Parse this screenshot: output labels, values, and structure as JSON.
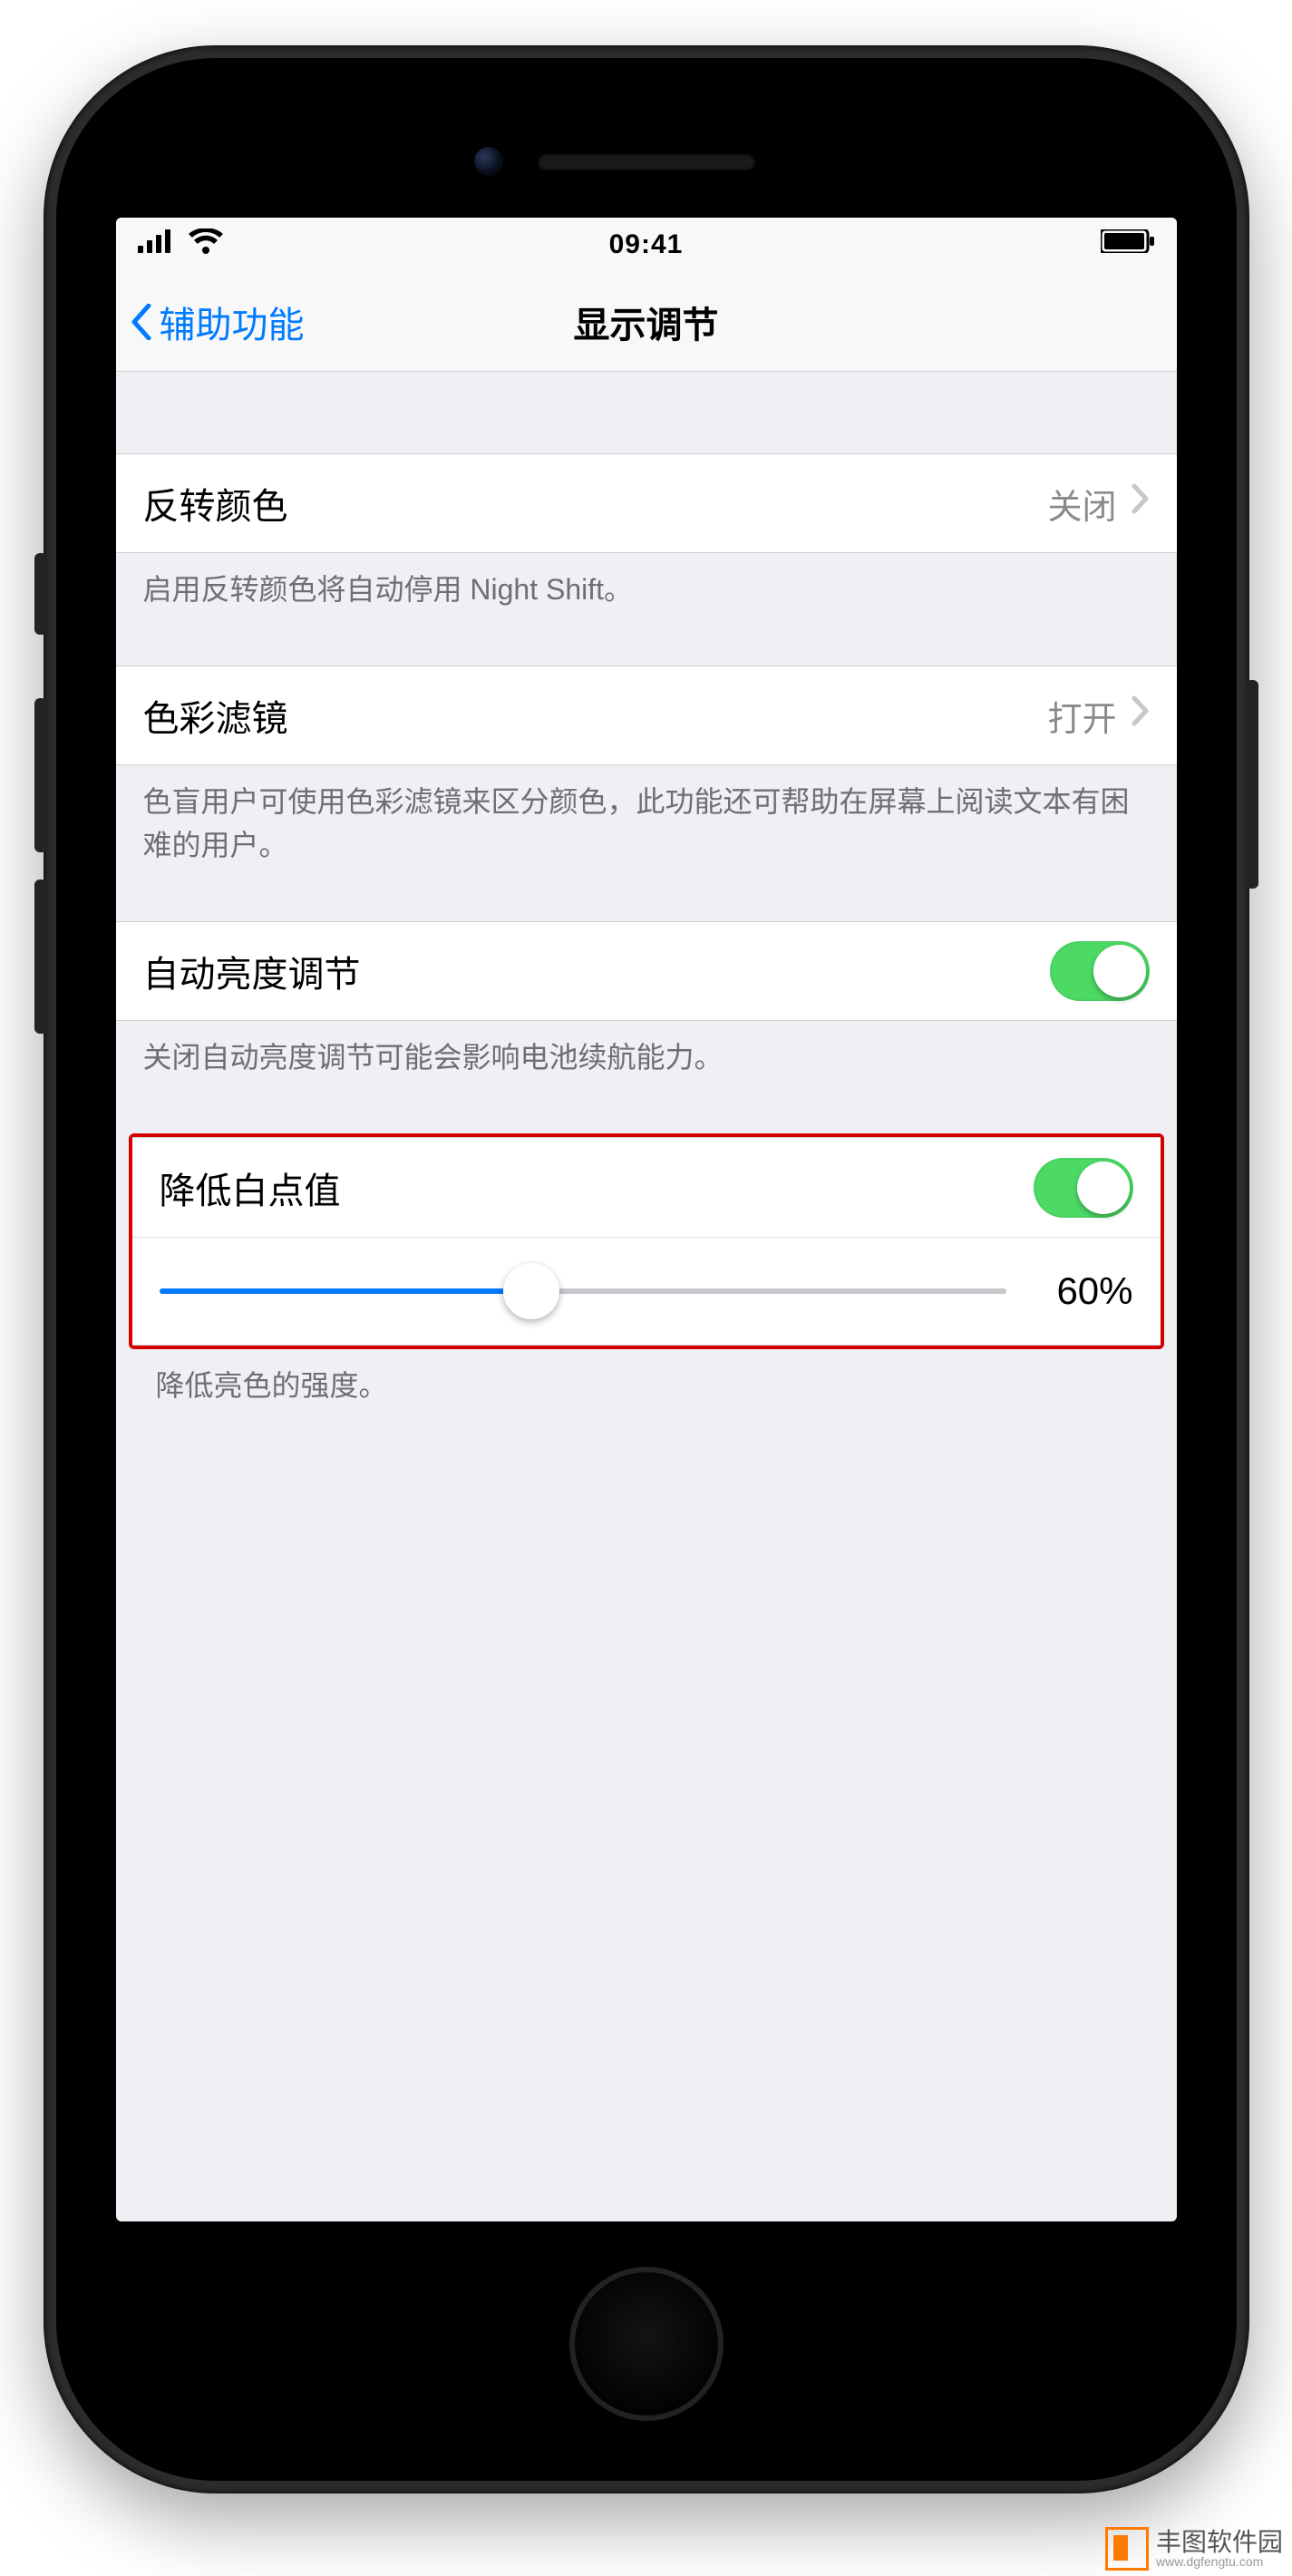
{
  "status": {
    "time": "09:41"
  },
  "nav": {
    "back": "辅助功能",
    "title": "显示调节"
  },
  "groups": {
    "invert": {
      "label": "反转颜色",
      "value": "关闭",
      "footer": "启用反转颜色将自动停用 Night Shift。"
    },
    "filter": {
      "label": "色彩滤镜",
      "value": "打开",
      "footer": "色盲用户可使用色彩滤镜来区分颜色，此功能还可帮助在屏幕上阅读文本有困难的用户。"
    },
    "autob": {
      "label": "自动亮度调节",
      "footer": "关闭自动亮度调节可能会影响电池续航能力。"
    },
    "white": {
      "label": "降低白点值",
      "slider_pct": 44,
      "value_text": "60%",
      "footer": "降低亮色的强度。"
    }
  },
  "watermark": {
    "name": "丰图软件园",
    "url": "www.dgfengtu.com"
  }
}
